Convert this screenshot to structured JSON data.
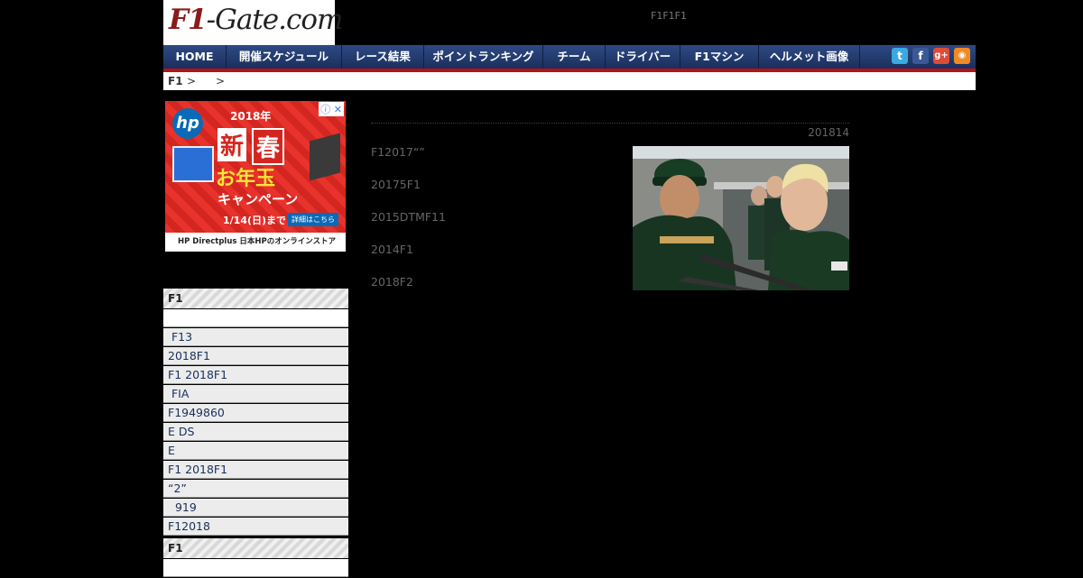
{
  "site": {
    "logo_prefix": "F1",
    "logo_suffix": "-Gate.com",
    "tagline": "F1F1F1"
  },
  "nav": {
    "items": [
      {
        "label": "HOME"
      },
      {
        "label": "開催スケジュール"
      },
      {
        "label": "レース結果"
      },
      {
        "label": "ポイントランキング"
      },
      {
        "label": "チーム"
      },
      {
        "label": "ドライバー"
      },
      {
        "label": "F1マシン"
      },
      {
        "label": "ヘルメット画像"
      }
    ],
    "social": [
      {
        "icon": "twitter-icon",
        "glyph": "t",
        "color": "#3aa9e0"
      },
      {
        "icon": "facebook-icon",
        "glyph": "f",
        "color": "#3b5998"
      },
      {
        "icon": "google-plus-icon",
        "glyph": "g+",
        "color": "#dd4b39"
      },
      {
        "icon": "rss-icon",
        "glyph": "◉",
        "color": "#f08a24"
      }
    ]
  },
  "breadcrumb": {
    "home": "F1",
    "sep1": ">",
    "sep2": ">"
  },
  "ad": {
    "year": "2018年",
    "word1": "新",
    "word2": "春",
    "otoshidama": "お年玉",
    "campaign": "キャンペーン",
    "date": "1/14(日)まで",
    "button": "詳細はこちら",
    "footer": "HP Directplus 日本HPのオンラインストア",
    "choice": "ⓘ ✕",
    "hp": "hp"
  },
  "sidebar": {
    "section1_title": "F1",
    "section1_items": [
      "",
      " F13",
      "2018F1",
      "F1 2018F1",
      " FIA",
      "F1949860",
      "E DS",
      "E",
      "F1 2018F1",
      "“2”",
      "  919",
      "F12018"
    ],
    "section2_title": "F1",
    "section2_first": ""
  },
  "article": {
    "date": "201814",
    "related": [
      "F12017“”",
      "20175F1",
      "2015DTMF11",
      "2014F1",
      "2018F2"
    ]
  }
}
